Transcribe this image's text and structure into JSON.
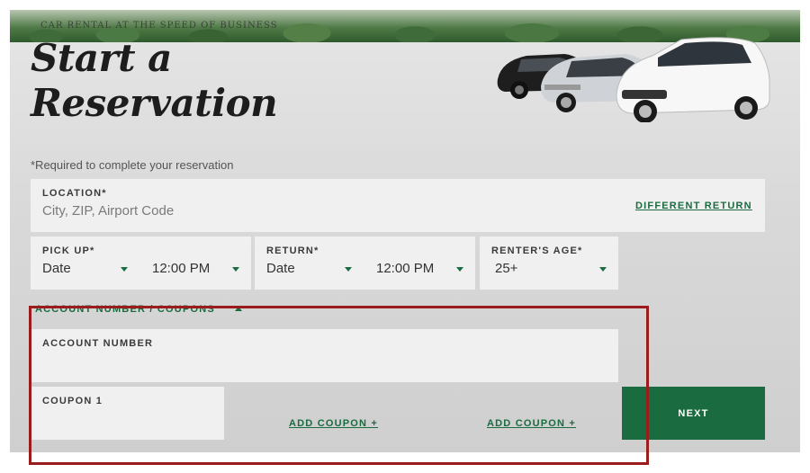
{
  "banner": {
    "text": "CAR RENTAL AT THE SPEED OF BUSINESS"
  },
  "page": {
    "title_line1": "Start a",
    "title_line2": "Reservation",
    "required_note": "*Required to complete your reservation"
  },
  "location": {
    "label": "LOCATION*",
    "placeholder": "City, ZIP, Airport Code",
    "different_return_link": "DIFFERENT RETURN"
  },
  "pickup": {
    "label": "PICK UP*",
    "date": "Date",
    "time": "12:00 PM"
  },
  "return": {
    "label": "RETURN*",
    "date": "Date",
    "time": "12:00 PM"
  },
  "renter_age": {
    "label": "RENTER'S AGE*",
    "value": "25+"
  },
  "account_section": {
    "toggle_label": "ACCOUNT NUMBER / COUPONS",
    "account_number_label": "ACCOUNT NUMBER",
    "coupon1_label": "COUPON 1",
    "add_coupon_1": "ADD COUPON +",
    "add_coupon_2": "ADD COUPON +"
  },
  "actions": {
    "next_label": "NEXT"
  },
  "colors": {
    "brand_green": "#1a6b3f",
    "highlight_red": "#9b1c1c",
    "panel_bg": "#dcdcdc"
  },
  "icons": {
    "dropdown": "chevron-down-icon",
    "collapse": "chevron-up-icon"
  }
}
